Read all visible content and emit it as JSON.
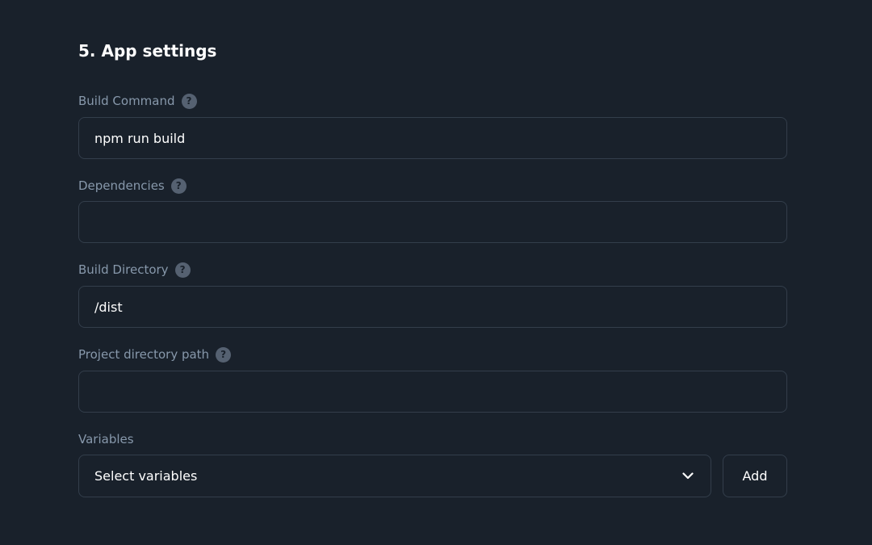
{
  "section": {
    "title": "5. App settings"
  },
  "fields": {
    "build_command": {
      "label": "Build Command",
      "help_icon": "question-circle-icon",
      "value": "npm run build",
      "placeholder": ""
    },
    "dependencies": {
      "label": "Dependencies",
      "help_icon": "question-circle-icon",
      "value": "",
      "placeholder": ""
    },
    "build_directory": {
      "label": "Build Directory",
      "help_icon": "question-circle-icon",
      "value": "/dist",
      "placeholder": ""
    },
    "project_directory_path": {
      "label": "Project directory path",
      "help_icon": "question-circle-icon",
      "value": "",
      "placeholder": ""
    }
  },
  "variables": {
    "label": "Variables",
    "select_value": "Select variables",
    "select_icon": "chevron-down-icon",
    "add_label": "Add"
  },
  "help_glyph": "?",
  "colors": {
    "background": "#19212b",
    "label": "#8798ab",
    "border": "#333e4b",
    "help_icon_bg": "#556171",
    "text": "#ffffff"
  }
}
